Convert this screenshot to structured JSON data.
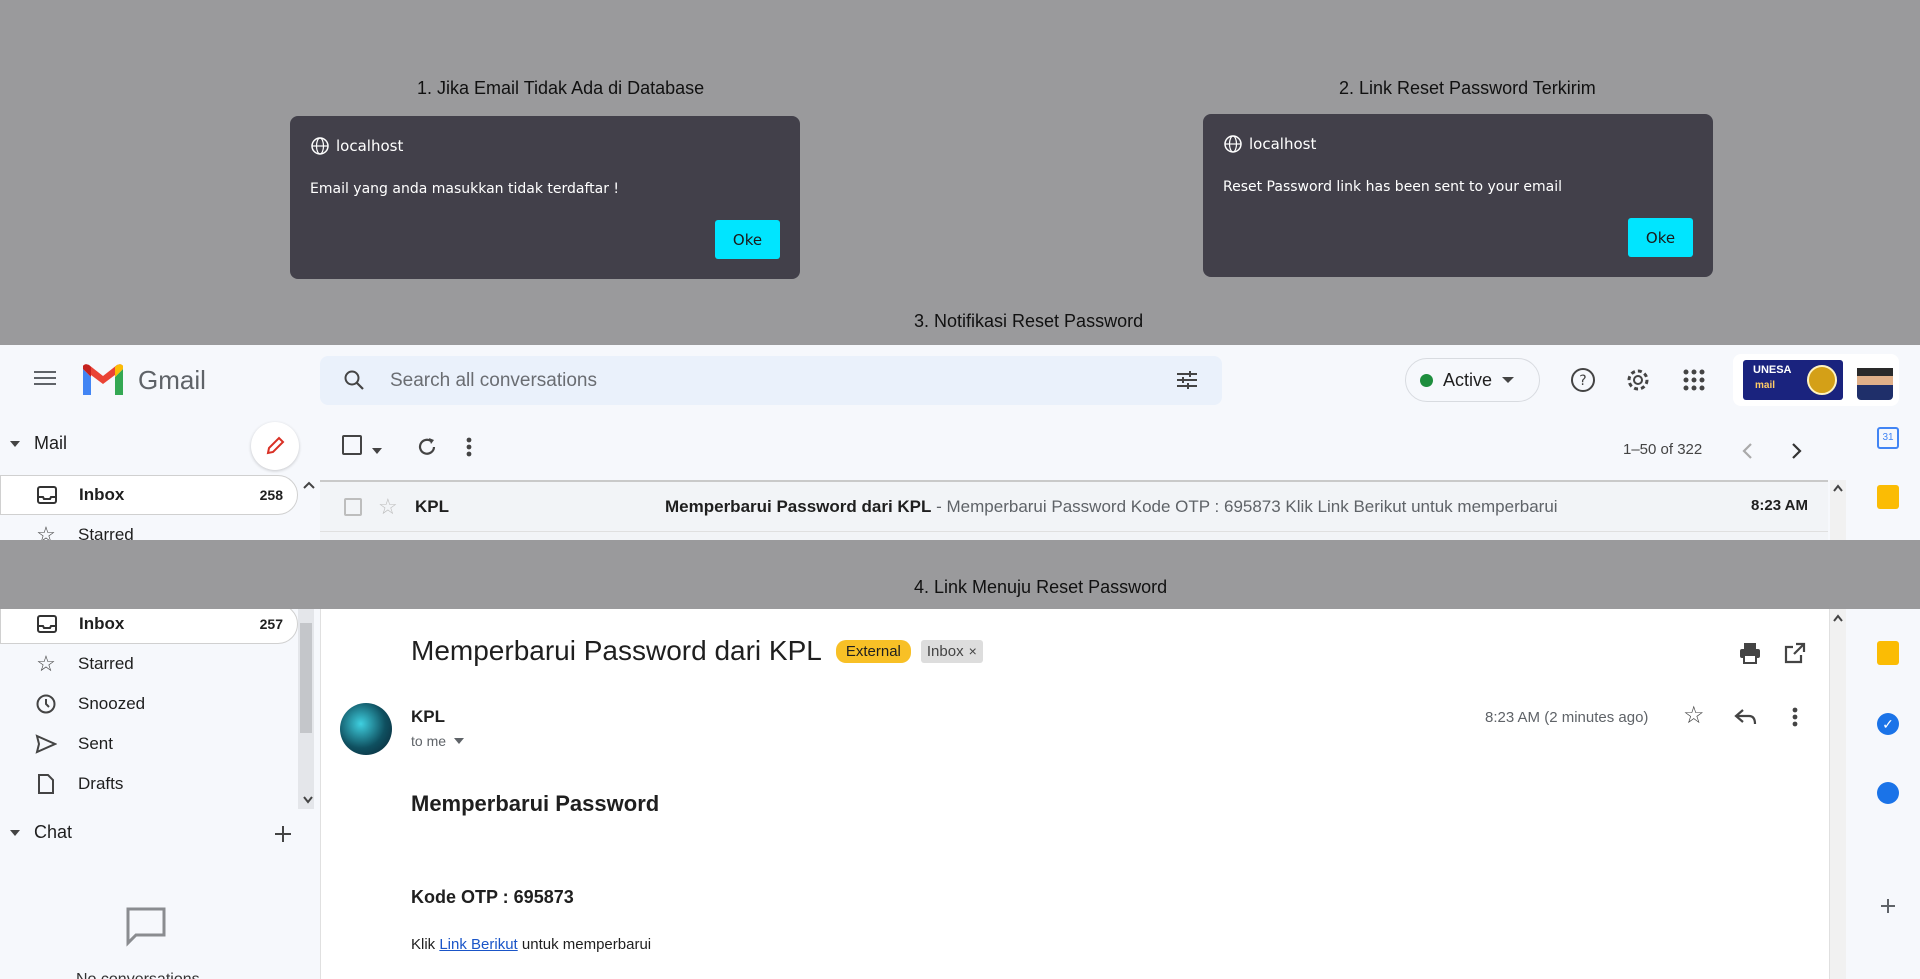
{
  "captions": {
    "c1": "1. Jika Email Tidak Ada di Database",
    "c2": "2. Link Reset Password Terkirim",
    "c3": "3. Notifikasi Reset Password",
    "c4": "4. Link Menuju  Reset Password"
  },
  "dialog1": {
    "host": "localhost",
    "message": "Email yang anda masukkan tidak terdaftar !",
    "ok": "Oke"
  },
  "dialog2": {
    "host": "localhost",
    "message": "Reset Password link has been sent to your email",
    "ok": "Oke"
  },
  "gmail": {
    "app_name": "Gmail",
    "search_placeholder": "Search all conversations",
    "status": "Active",
    "account_logo_text": "UNESA",
    "account_logo_sub": "mail",
    "mail_label": "Mail",
    "chat_label": "Chat",
    "no_conversations": "No conversations",
    "pager": "1–50 of 322",
    "nav_list": [
      {
        "label": "Inbox",
        "count": "258"
      },
      {
        "label": "Starred"
      }
    ],
    "nav_detail": [
      {
        "label": "Inbox",
        "count": "257"
      },
      {
        "label": "Starred"
      },
      {
        "label": "Snoozed"
      },
      {
        "label": "Sent"
      },
      {
        "label": "Drafts"
      }
    ],
    "row": {
      "sender": "KPL",
      "subject": "Memperbarui Password dari KPL",
      "snippet": " - Memperbarui Password Kode OTP : 695873 Klik Link Berikut untuk memperbarui",
      "time": "8:23 AM"
    },
    "message": {
      "subject": "Memperbarui Password dari KPL",
      "badge_external": "External",
      "badge_inbox": "Inbox",
      "sender": "KPL",
      "to": "to me",
      "time": "8:23 AM (2 minutes ago)",
      "heading": "Memperbarui Password",
      "otp": "Kode OTP : 695873",
      "link_prefix": "Klik ",
      "link_text": "Link Berikut",
      "link_suffix": " untuk memperbarui"
    },
    "colors": {
      "accent_status": "#1e8e3e",
      "external_badge": "#f8c026",
      "ok_button": "#00e5ff"
    },
    "calendar_day": "31"
  }
}
